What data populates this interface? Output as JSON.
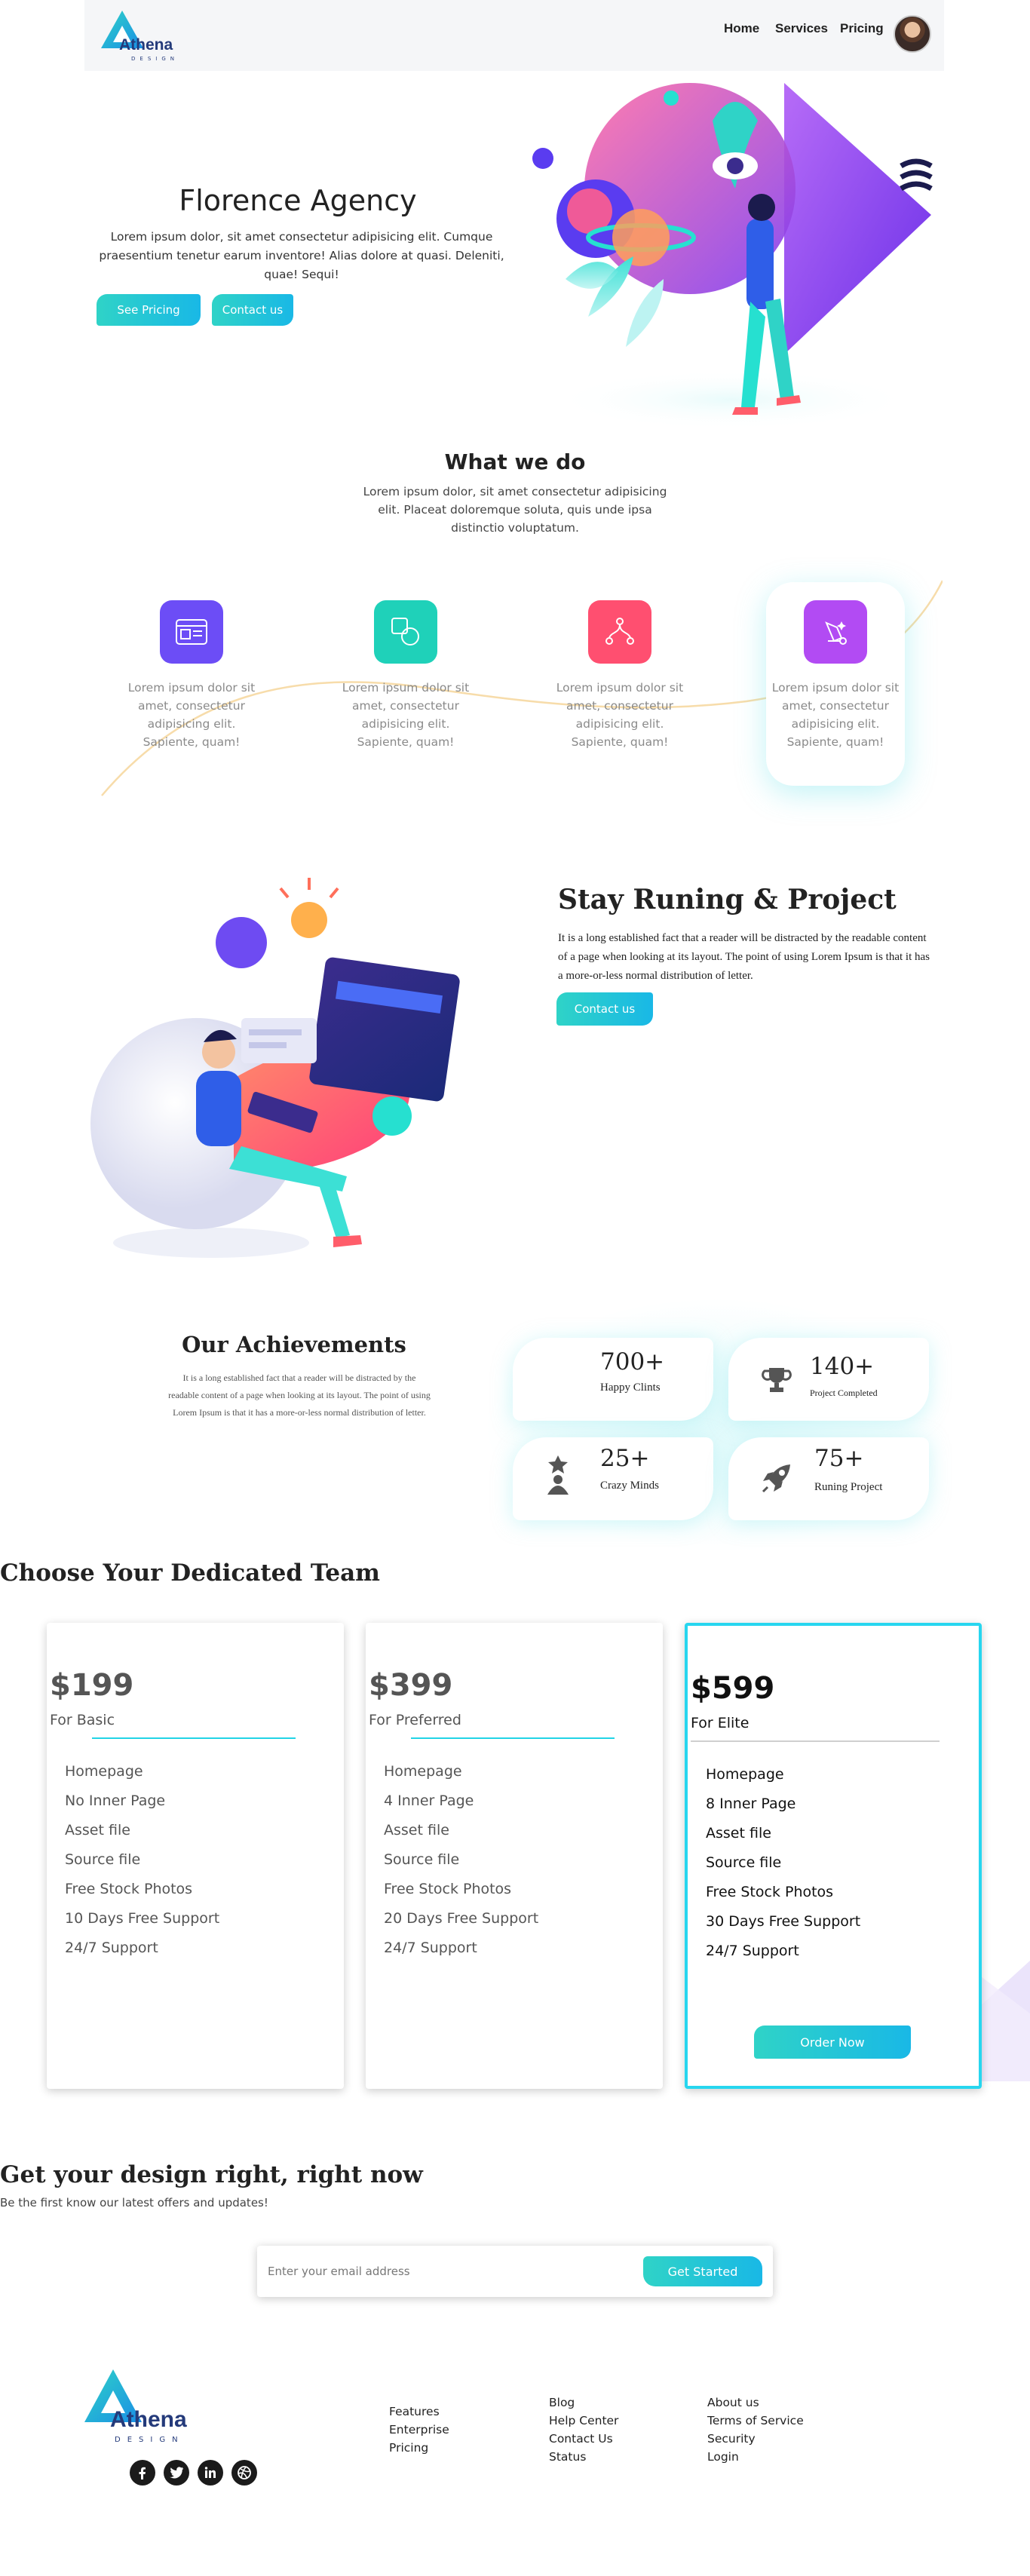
{
  "nav": {
    "brand": "Athena",
    "brand_sub": "DESIGN",
    "links": [
      "Home",
      "Services",
      "Pricing"
    ]
  },
  "hero": {
    "title": "Florence Agency",
    "text": "Lorem ipsum dolor, sit amet consectetur adipisicing elit. Cumque praesentium tenetur earum inventore! Alias dolore at quasi. Deleniti, quae! Sequi!",
    "btn_pricing": "See Pricing",
    "btn_contact": "Contact us"
  },
  "what_we_do": {
    "title": "What we do",
    "text": "Lorem ipsum dolor, sit amet consectetur adipisicing elit. Placeat doloremque soluta, quis unde ipsa distinctio voluptatum.",
    "features": [
      {
        "icon": "browser-icon",
        "color": "#6c4df6",
        "text": "Lorem ipsum dolor sit amet, consectetur adipisicing elit. Sapiente, quam!"
      },
      {
        "icon": "shapes-icon",
        "color": "#1fd1b9",
        "text": "Lorem ipsum dolor sit amet, consectetur adipisicing elit. Sapiente, quam!"
      },
      {
        "icon": "nodes-icon",
        "color": "#ff4f70",
        "text": "Lorem ipsum dolor sit amet, consectetur adipisicing elit. Sapiente, quam!"
      },
      {
        "icon": "pen-tool-icon",
        "color": "#b24bf3",
        "text": "Lorem ipsum dolor sit amet, consectetur adipisicing elit. Sapiente, quam!"
      }
    ]
  },
  "stay_running": {
    "title": "Stay Runing & Project",
    "text": "It is a long established fact that a reader will be distracted by the readable content of a page when looking at its layout. The point of using Lorem Ipsum is that it has a more-or-less normal distribution of letter.",
    "button": "Contact us"
  },
  "achievements": {
    "title": "Our Achievements",
    "text": "It is a long established fact that a reader will be distracted by the readable content of a page when looking at its layout. The point of using Lorem Ipsum is that it has a more-or-less normal distribution of letter.",
    "stats": [
      {
        "value": "700+",
        "label": "Happy Clints",
        "icon": ""
      },
      {
        "value": "140+",
        "label": "Project Completed",
        "icon": "trophy-icon"
      },
      {
        "value": "25+",
        "label": "Crazy Minds",
        "icon": "person-star-icon"
      },
      {
        "value": "75+",
        "label": "Runing Project",
        "icon": "rocket-icon"
      }
    ]
  },
  "pricing": {
    "title": "Choose Your Dedicated Team",
    "accent": "#27d6ef",
    "plans": [
      {
        "price": "$199",
        "name": "For Basic",
        "features": [
          "Homepage",
          "No Inner Page",
          "Asset file",
          "Source file",
          "Free Stock Photos",
          "10 Days Free Support",
          "24/7 Support"
        ]
      },
      {
        "price": "$399",
        "name": "For Preferred",
        "features": [
          "Homepage",
          "4 Inner Page",
          "Asset file",
          "Source file",
          "Free Stock Photos",
          "20 Days Free Support",
          "24/7 Support"
        ]
      },
      {
        "price": "$599",
        "name": "For Elite",
        "features": [
          "Homepage",
          "8 Inner Page",
          "Asset file",
          "Source file",
          "Free Stock Photos",
          "30 Days Free Support",
          "24/7 Support"
        ],
        "button": "Order Now"
      }
    ]
  },
  "newsletter": {
    "title": "Get your design right, right now",
    "subtitle": "Be the first know our latest offers and updates!",
    "placeholder": "Enter your email address",
    "button": "Get Started"
  },
  "footer": {
    "brand": "Athena",
    "brand_sub": "DESIGN",
    "social": [
      "facebook-icon",
      "twitter-icon",
      "linkedin-icon",
      "dribbble-icon"
    ],
    "col1": [
      "Features",
      "Enterprise",
      "Pricing"
    ],
    "col2": [
      "Blog",
      "Help Center",
      "Contact Us",
      "Status"
    ],
    "col3": [
      "About us",
      "Terms of Service",
      "Security",
      "Login"
    ]
  }
}
